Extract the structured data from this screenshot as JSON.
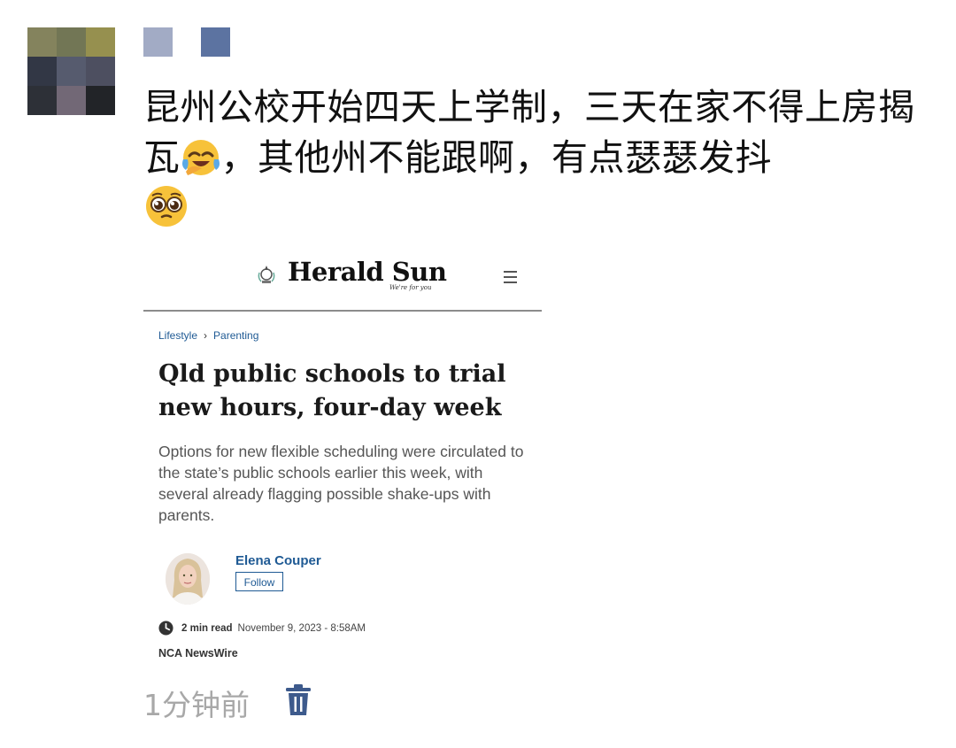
{
  "avatar_colors": [
    "#84835d",
    "#727655",
    "#96904f",
    "#323745",
    "#565b6e",
    "#4d4f60",
    "#2d3037",
    "#726876",
    "#222428"
  ],
  "name_blur_colors": [
    "#a2abc5",
    "#5c73a1"
  ],
  "post": {
    "text": "昆州公校开始四天上学制，三天在家不得上房揭瓦",
    "text_after_emoji1": "，其他州不能跟啊，有点瑟瑟发抖",
    "emoji1": "face-with-tears-of-joy",
    "emoji2": "pleading-face"
  },
  "shared_card": {
    "masthead": {
      "title": "Herald Sun",
      "tagline": "We're for you",
      "menu_icon": "hamburger-menu-icon"
    },
    "breadcrumb": {
      "section": "Lifestyle",
      "subsection": "Parenting"
    },
    "headline": "Qld public schools to trial new hours, four-day week",
    "standfirst": "Options for new flexible scheduling were circulated to the state’s public schools earlier this week, with several already flagging possible shake-ups with parents.",
    "author": {
      "name": "Elena Couper",
      "follow_label": "Follow"
    },
    "read_time": "2 min read",
    "date": "November 9, 2023 - 8:58AM",
    "source": "NCA NewsWire",
    "link_color": "#1f5a94"
  },
  "footer": {
    "timestamp": "1分钟前",
    "delete_icon": "trash-icon",
    "delete_color": "#3d5a8c"
  }
}
